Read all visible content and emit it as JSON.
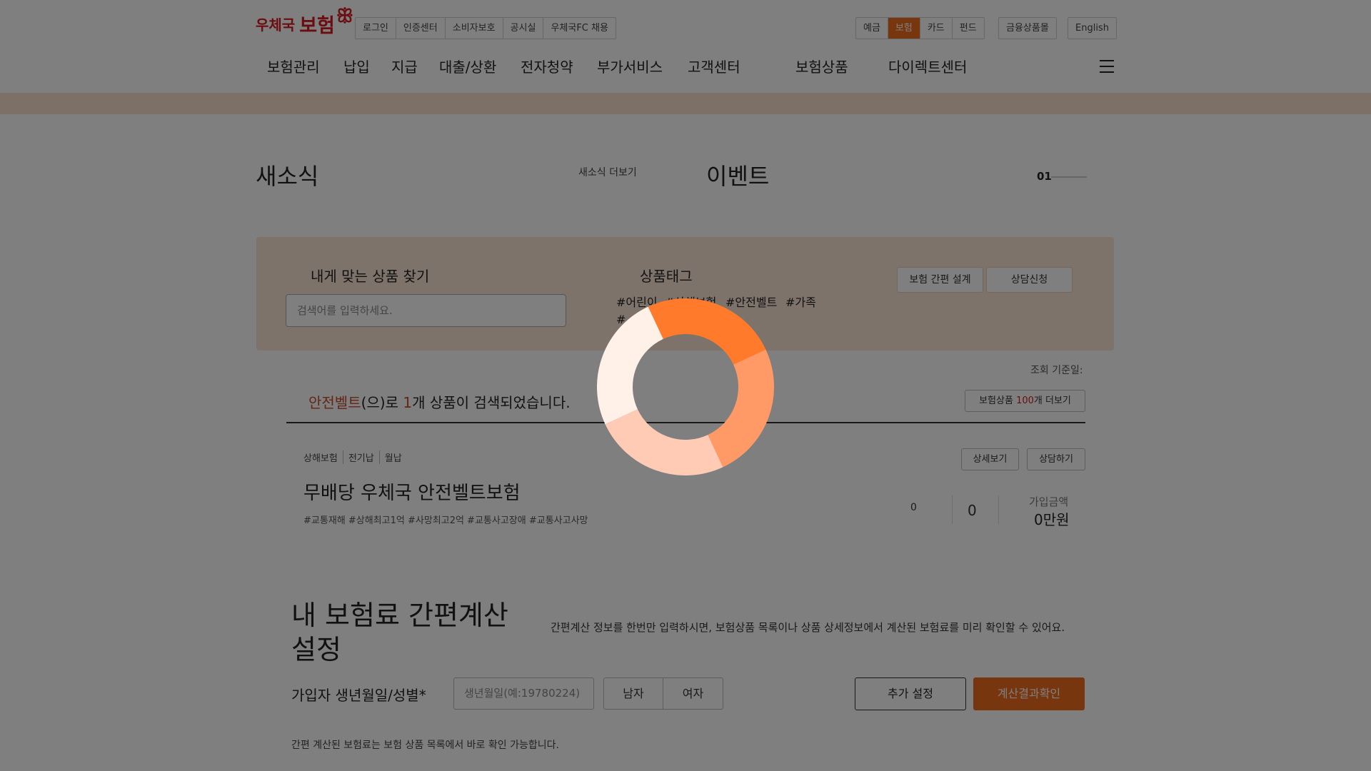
{
  "header": {
    "logo_text_1": "우체국",
    "logo_text_2": "보험",
    "util_links": [
      "로그인",
      "인증센터",
      "소비자보호",
      "공시실",
      "우체국FC 채용"
    ],
    "categories": [
      {
        "label": "예금",
        "active": false
      },
      {
        "label": "보험",
        "active": true
      },
      {
        "label": "카드",
        "active": false
      },
      {
        "label": "펀드",
        "active": false
      }
    ],
    "mall_label": "금융상품몰",
    "english_label": "English",
    "gnb": [
      "보험관리",
      "납입",
      "지급",
      "대출/상환",
      "전자청약",
      "부가서비스",
      "고객센터",
      "보험상품",
      "다이렉트센터"
    ],
    "accent_color": "#f06d1e",
    "brand_color": "#d71a21"
  },
  "news": {
    "title": "새소식",
    "more_label": "새소식 더보기"
  },
  "event": {
    "title": "이벤트",
    "page": "01"
  },
  "search_panel": {
    "find_title": "내게 맞는 상품 찾기",
    "input_placeholder": "검색어를 입력하세요.",
    "tag_title": "상품태그",
    "tags": [
      "#어린이",
      "#상해보험",
      "#안전벨트",
      "#가족",
      "#"
    ],
    "design_button": "보험 간편 설계",
    "consult_button": "상담신청"
  },
  "results": {
    "basis_label": "조회 기준일:",
    "keyword": "안전벨트",
    "line_part1": "(으)로 ",
    "count": "1",
    "line_part2": "개 상품이 검색되었습니다.",
    "more_prefix": "보험상품 ",
    "more_count": "100",
    "more_suffix": "개 더보기"
  },
  "product": {
    "meta": [
      "상해보험",
      "전기납",
      "월납"
    ],
    "name": "무배당 우체국 안전벨트보험",
    "hashtags": "#교통재해 #상해최고1억 #사망최고2억 #교통사고장애 #교통사고사망",
    "detail_button": "상세보기",
    "consult_button": "상담하기",
    "value_1": "0",
    "value_2": "0",
    "amount_label": "가입금액",
    "amount_value": "0만원"
  },
  "calc": {
    "title": "내 보험료 간편계산 설정",
    "description": "간편계산 정보를 한번만 입력하시면, 보험상품 목록이나 상품 상세정보에서 계산된 보험료를 미리 확인할 수 있어요.",
    "birth_label": "가입자 생년월일/성별*",
    "birth_placeholder": "생년월일(예:19780224)",
    "gender_male": "남자",
    "gender_female": "여자",
    "extra_button": "추가 설정",
    "result_button": "계산결과확인",
    "note": "간편 계산된 보험료는 보험 상품 목록에서 바로 확인 가능합니다."
  },
  "loading": {
    "icon": "loading-spinner-icon",
    "colors": [
      "#ff7a2a",
      "#ff9966",
      "#ffcbb5",
      "#fff0e8"
    ]
  }
}
